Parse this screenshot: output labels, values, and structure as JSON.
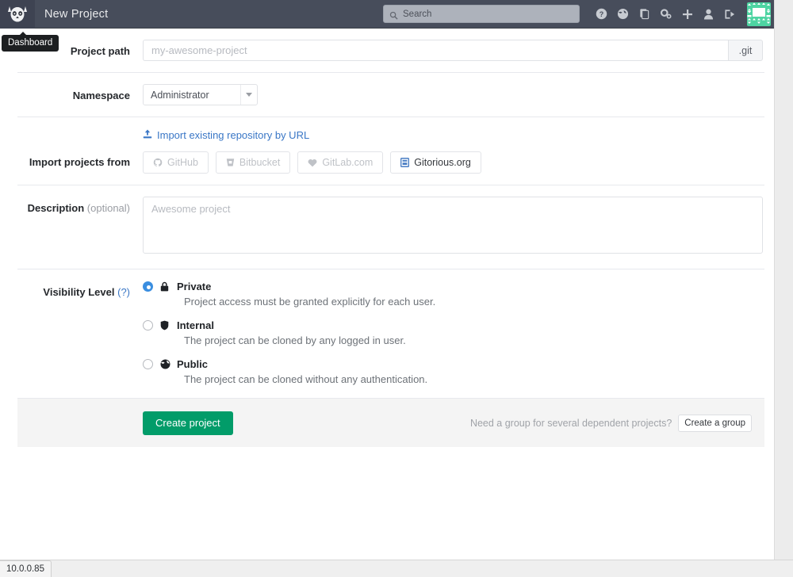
{
  "navbar": {
    "logo_icon": "gitlab-tanuki-icon",
    "title": "New Project",
    "search": {
      "placeholder": "Search",
      "icon": "search-icon",
      "value": ""
    },
    "icons": [
      {
        "name": "help-icon",
        "label": "Help"
      },
      {
        "name": "globe-public-icon",
        "label": "Public area"
      },
      {
        "name": "clipboard-issues-icon",
        "label": "Issues"
      },
      {
        "name": "admin-gears-icon",
        "label": "Admin area"
      },
      {
        "name": "plus-new-icon",
        "label": "New"
      },
      {
        "name": "user-profile-icon",
        "label": "Profile settings"
      },
      {
        "name": "sign-out-icon",
        "label": "Sign out"
      }
    ],
    "avatar": {
      "name": "user-avatar-identicon",
      "bg_color": "#4ed4a2"
    }
  },
  "tooltip": {
    "text": "Dashboard"
  },
  "form": {
    "project_path": {
      "label": "Project path",
      "placeholder": "my-awesome-project",
      "value": "",
      "suffix": ".git"
    },
    "namespace": {
      "label": "Namespace",
      "selected": "Administrator",
      "options": [
        "Administrator"
      ]
    },
    "import": {
      "url_link": "Import existing repository by URL",
      "url_link_icon": "upload-icon",
      "label": "Import projects from",
      "buttons": [
        {
          "label": "GitHub",
          "icon": "github-icon",
          "enabled": false
        },
        {
          "label": "Bitbucket",
          "icon": "bitbucket-icon",
          "enabled": false
        },
        {
          "label": "GitLab.com",
          "icon": "heart-gitlab-icon",
          "enabled": false
        },
        {
          "label": "Gitorious.org",
          "icon": "gitorious-icon",
          "enabled": true
        }
      ]
    },
    "description": {
      "label": "Description",
      "label_optional": "(optional)",
      "placeholder": "Awesome project",
      "value": ""
    },
    "visibility": {
      "label": "Visibility Level",
      "help": "(?)",
      "selected": "Private",
      "levels": [
        {
          "name": "Private",
          "icon": "lock-icon",
          "description": "Project access must be granted explicitly for each user.",
          "selected": true
        },
        {
          "name": "Internal",
          "icon": "shield-icon",
          "description": "The project can be cloned by any logged in user.",
          "selected": false
        },
        {
          "name": "Public",
          "icon": "globe-icon",
          "description": "The project can be cloned without any authentication.",
          "selected": false
        }
      ]
    }
  },
  "actions": {
    "create_project": "Create project",
    "group_hint": "Need a group for several dependent projects?",
    "create_group": "Create a group",
    "primary_color": "#029c69"
  },
  "statusbar": {
    "url": "10.0.0.85"
  }
}
